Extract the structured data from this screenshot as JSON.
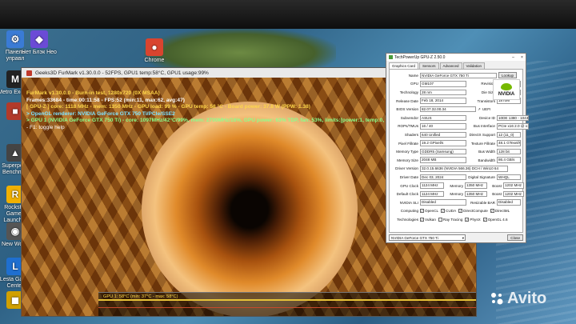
{
  "desktop_icons": [
    {
      "label": "Панель управл",
      "glyph": "⚙",
      "color": "#3a7bd5"
    },
    {
      "label": "Нет Блэк Нео",
      "glyph": "◆",
      "color": "#6b4bd6"
    },
    {
      "label": "Chrome",
      "glyph": "●",
      "color": "#d9442f"
    },
    {
      "label": "Metro Exodus",
      "glyph": "M",
      "color": "#222"
    },
    {
      "label": "",
      "glyph": "■",
      "color": "#b23a2a"
    },
    {
      "label": "Superposit Benchmar",
      "glyph": "▲",
      "color": "#444"
    },
    {
      "label": "Rockstar Games Launcher",
      "glyph": "R",
      "color": "#f0b000"
    },
    {
      "label": "New World",
      "glyph": "◉",
      "color": "#555"
    },
    {
      "label": "Lesta Game Center",
      "glyph": "L",
      "color": "#1f6fd0"
    },
    {
      "label": "",
      "glyph": "◼",
      "color": "#d0a000"
    }
  ],
  "furmark": {
    "window_title": "Geeks3D FurMark v1.30.0.0 - 52FPS, GPU1 temp:58°C, GPU1 usage:99%",
    "overlay": {
      "title": "FurMark v1.30.0.0 - Burn-in test, 1280x720 (0X MSAA)",
      "frames": "Frames:33684 - time:00:11:58 - FPS:52 (min:11, max:62, avg:47)",
      "gpu_stats": "[ GPU-Z ] core: 1118 MHz - mem: 1350 MHz - GPU load: 99 % - GPU temp: 58 °C - Board power: 37.8 W (PPW: 1.38)",
      "opengl": "> OpenGL renderer: NVIDIA GeForce GTX 750 Ti/PCIe/SSE2",
      "gpu1": "> GPU 1 (NVIDIA GeForce GTX 750 Ti) - core: 1097MHz/42°C/99%, mem: 2700MHz/16%, GPU power: 63% TDP, fan: 53%, limits:[power:1, temp:0, volt:0, OV:0]",
      "help": "- F1: toggle help"
    },
    "graph_label": "GPU 1: 58°C (min: 37°C - max: 58°C)"
  },
  "gpuz": {
    "title": "TechPowerUp GPU-Z 2.50.0",
    "tabs": [
      "Graphics Card",
      "Sensors",
      "Advanced",
      "Validation"
    ],
    "lookup_label": "Lookup",
    "rows": [
      {
        "label": "Name",
        "value": "NVIDIA GeForce GTX 750 Ti"
      },
      {
        "label": "GPU",
        "value": "GM107",
        "sub_label": "Revision",
        "sub_value": "A2"
      },
      {
        "label": "Technology",
        "value": "28 nm",
        "sub_label": "Die Size",
        "sub_value": "148 mm²"
      },
      {
        "label": "Release Date",
        "value": "Feb 18, 2014",
        "sub_label": "Transistors",
        "sub_value": "1870M"
      },
      {
        "label": "BIOS Version",
        "value": "82.07.32.00.34",
        "extra": "UEFI"
      },
      {
        "label": "Subvendor",
        "value": "ASUS",
        "sub_label": "Device ID",
        "sub_value": "10DE 1380 - 1043 8567"
      },
      {
        "label": "ROPs/TMUs",
        "value": "16 / 40",
        "sub_label": "Bus Interface",
        "sub_value": "PCIe x16 2.0 @ x16 2.0"
      },
      {
        "label": "Shaders",
        "value": "640 Unified",
        "sub_label": "DirectX Support",
        "sub_value": "12 (11_0)"
      },
      {
        "label": "Pixel Fillrate",
        "value": "19.2 GPixel/s",
        "sub_label": "Texture Fillrate",
        "sub_value": "48.1 GTexel/s"
      },
      {
        "label": "Memory Type",
        "value": "GDDR5 (Samsung)",
        "sub_label": "Bus Width",
        "sub_value": "128 bit"
      },
      {
        "label": "Memory Size",
        "value": "2048 MB",
        "sub_label": "Bandwidth",
        "sub_value": "86.4 GB/s"
      },
      {
        "label": "Driver Version",
        "value": "32.0.15.6636 (NVIDIA 566.36) DCH / Win10 64"
      },
      {
        "label": "Driver Date",
        "value": "Dec 03, 2024",
        "sub_label": "Digital Signature",
        "sub_value": "WHQL"
      },
      {
        "label": "GPU Clock",
        "value": "1124 MHz",
        "sub_label": "Memory",
        "sub_value": "1350 MHz",
        "sub2_label": "Boost",
        "sub2_value": "1202 MHz"
      },
      {
        "label": "Default Clock",
        "value": "1124 MHz",
        "sub_label": "Memory",
        "sub_value": "1350 MHz",
        "sub2_label": "Boost",
        "sub2_value": "1202 MHz"
      },
      {
        "label": "NVIDIA SLI",
        "value": "Disabled",
        "sub_label": "Resizable BAR",
        "sub_value": "Disabled"
      }
    ],
    "computing_label": "Computing",
    "computing": [
      {
        "name": "OpenCL",
        "checked": true
      },
      {
        "name": "CUDA",
        "checked": true
      },
      {
        "name": "DirectCompute",
        "checked": true
      },
      {
        "name": "DirectML",
        "checked": true
      }
    ],
    "technologies_label": "Technologies",
    "technologies": [
      {
        "name": "Vulkan",
        "checked": true
      },
      {
        "name": "Ray Tracing",
        "checked": false
      },
      {
        "name": "PhysX",
        "checked": true
      },
      {
        "name": "OpenGL 4.6",
        "checked": true
      }
    ],
    "selected_gpu": "NVIDIA GeForce GTX 750 Ti",
    "close_label": "Close"
  },
  "watermark": "Avito"
}
